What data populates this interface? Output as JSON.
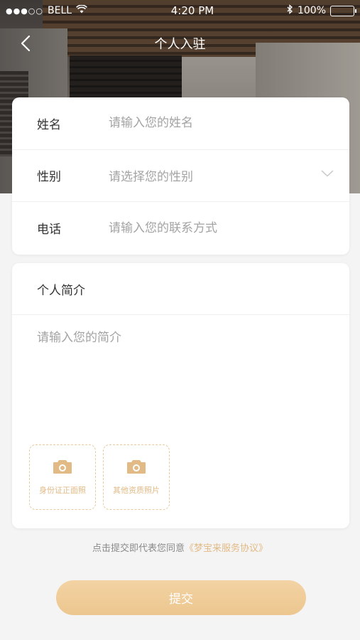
{
  "status_bar": {
    "signal": "●●●○○",
    "carrier": "BELL",
    "time": "4:20 PM",
    "battery_percent": "100%"
  },
  "nav": {
    "title": "个人入驻",
    "back_icon": "chevron-left-icon"
  },
  "form": {
    "name": {
      "label": "姓名",
      "placeholder": "请输入您的姓名"
    },
    "gender": {
      "label": "性别",
      "placeholder": "请选择您的性别",
      "icon": "chevron-down-icon"
    },
    "phone": {
      "label": "电话",
      "placeholder": "请输入您的联系方式"
    }
  },
  "intro": {
    "title": "个人简介",
    "placeholder": "请输入您的简介",
    "uploads": [
      {
        "label": "身份证正面照",
        "icon": "camera-icon"
      },
      {
        "label": "其他资质照片",
        "icon": "camera-icon"
      }
    ]
  },
  "agreement": {
    "prefix": "点击提交即代表您同意",
    "link": "《梦宝来服务协议》"
  },
  "submit": {
    "label": "提交"
  },
  "colors": {
    "accent": "#e2ba86",
    "button": "#ecc68e",
    "background": "#f4f4f4"
  }
}
